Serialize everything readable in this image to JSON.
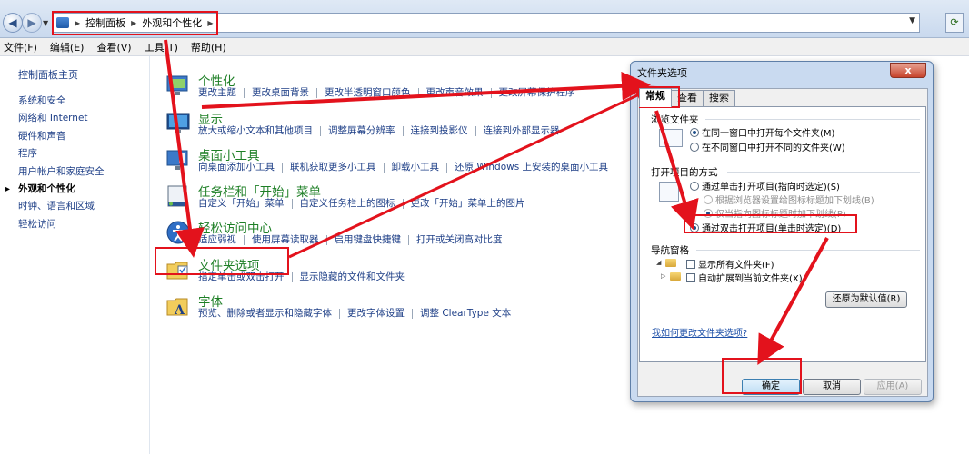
{
  "address_bar": {
    "back_icon": "back-arrow-icon",
    "forward_icon": "forward-arrow-icon",
    "breadcrumb": [
      "控制面板",
      "外观和个性化"
    ],
    "refresh_icon": "refresh-icon"
  },
  "menu": [
    "文件(F)",
    "编辑(E)",
    "查看(V)",
    "工具(T)",
    "帮助(H)"
  ],
  "left_nav": {
    "home": "控制面板主页",
    "items": [
      "系统和安全",
      "网络和 Internet",
      "硬件和声音",
      "程序",
      "用户帐户和家庭安全",
      "外观和个性化",
      "时钟、语言和区域",
      "轻松访问"
    ],
    "active_index": 5
  },
  "categories": [
    {
      "title": "个性化",
      "icon": "personalization-icon",
      "links": [
        "更改主题",
        "更改桌面背景",
        "更改半透明窗口颜色",
        "更改声音效果",
        "更改屏幕保护程序"
      ]
    },
    {
      "title": "显示",
      "icon": "display-icon",
      "links": [
        "放大或缩小文本和其他项目",
        "调整屏幕分辨率",
        "连接到投影仪",
        "连接到外部显示器"
      ]
    },
    {
      "title": "桌面小工具",
      "icon": "gadgets-icon",
      "links": [
        "向桌面添加小工具",
        "联机获取更多小工具",
        "卸载小工具",
        "还原 Windows 上安装的桌面小工具"
      ]
    },
    {
      "title": "任务栏和「开始」菜单",
      "icon": "taskbar-icon",
      "links": [
        "自定义「开始」菜单",
        "自定义任务栏上的图标",
        "更改「开始」菜单上的图片"
      ]
    },
    {
      "title": "轻松访问中心",
      "icon": "ease-of-access-icon",
      "links": [
        "适应弱视",
        "使用屏幕读取器",
        "启用键盘快捷键",
        "打开或关闭高对比度"
      ]
    },
    {
      "title": "文件夹选项",
      "icon": "folder-options-icon",
      "links": [
        "指定单击或双击打开",
        "显示隐藏的文件和文件夹"
      ]
    },
    {
      "title": "字体",
      "icon": "fonts-icon",
      "links": [
        "预览、删除或者显示和隐藏字体",
        "更改字体设置",
        "调整 ClearType 文本"
      ]
    }
  ],
  "dialog": {
    "title": "文件夹选项",
    "close_label": "x",
    "tabs": [
      "常规",
      "查看",
      "搜索"
    ],
    "browse_group": {
      "label": "浏览文件夹",
      "options": [
        "在同一窗口中打开每个文件夹(M)",
        "在不同窗口中打开不同的文件夹(W)"
      ]
    },
    "click_group": {
      "label": "打开项目的方式",
      "options": [
        "通过单击打开项目(指向时选定)(S)",
        "根据浏览器设置给图标标题加下划线(B)",
        "仅当指向图标标题时加下划线(P)",
        "通过双击打开项目(单击时选定)(D)"
      ]
    },
    "nav_group": {
      "label": "导航窗格",
      "options": [
        "显示所有文件夹(F)",
        "自动扩展到当前文件夹(X)"
      ]
    },
    "restore_button": "还原为默认值(R)",
    "help_link": "我如何更改文件夹选项?",
    "ok_button": "确定",
    "cancel_button": "取消",
    "apply_button": "应用(A)"
  },
  "colors": {
    "annotation_red": "#e3121c",
    "category_title_green": "#1e7f26",
    "link_blue": "#1e3f87"
  }
}
